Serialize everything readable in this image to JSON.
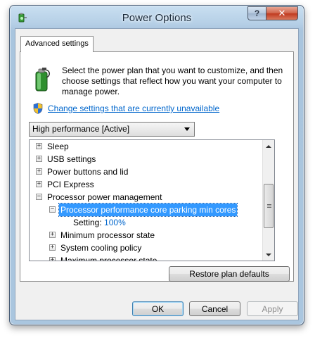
{
  "window": {
    "title": "Power Options"
  },
  "titlebar": {
    "help_label": "?",
    "close_label": "✕"
  },
  "tabs": [
    {
      "label": "Advanced settings"
    }
  ],
  "intro_text": "Select the power plan that you want to customize, and then choose settings that reflect how you want your computer to manage power.",
  "change_settings_link": "Change settings that are currently unavailable",
  "plan_select": {
    "value": "High performance [Active]"
  },
  "tree": {
    "items": [
      {
        "label": "Sleep",
        "toggle": "+"
      },
      {
        "label": "USB settings",
        "toggle": "+"
      },
      {
        "label": "Power buttons and lid",
        "toggle": "+"
      },
      {
        "label": "PCI Express",
        "toggle": "+"
      },
      {
        "label": "Processor power management",
        "toggle": "−"
      },
      {
        "label": "Processor performance core parking min cores",
        "toggle": "−"
      },
      {
        "setting_label": "Setting:",
        "setting_value": "100%"
      },
      {
        "label": "Minimum processor state",
        "toggle": "+"
      },
      {
        "label": "System cooling policy",
        "toggle": "+"
      },
      {
        "label": "Maximum processor state",
        "toggle": "+"
      }
    ]
  },
  "buttons": {
    "restore": "Restore plan defaults",
    "ok": "OK",
    "cancel": "Cancel",
    "apply": "Apply"
  },
  "colors": {
    "selection": "#3399ff",
    "link": "#0066cc",
    "close_button": "#c0391f"
  },
  "icons": {
    "app": "power-options-icon",
    "plan": "battery-plug-icon",
    "link": "uac-shield-icon"
  }
}
